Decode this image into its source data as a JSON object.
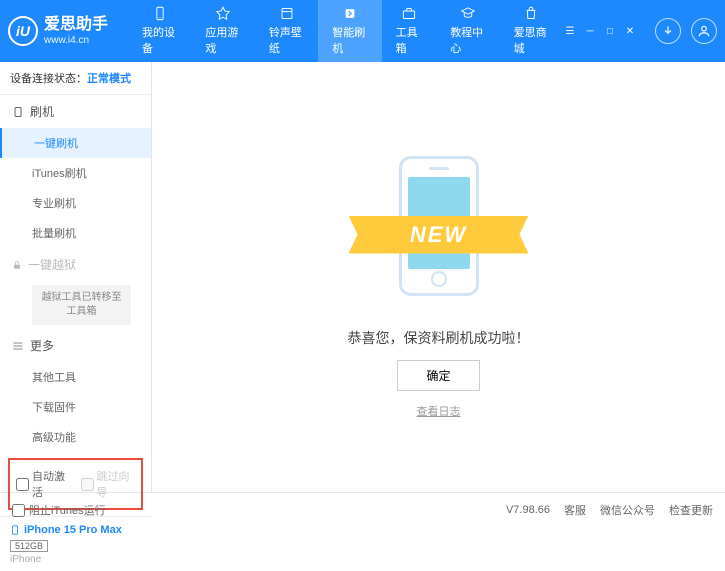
{
  "brand": {
    "title": "爱思助手",
    "url": "www.i4.cn",
    "logo_letter": "iU"
  },
  "topnav": {
    "items": [
      {
        "label": "我的设备"
      },
      {
        "label": "应用游戏"
      },
      {
        "label": "铃声壁纸"
      },
      {
        "label": "智能刷机"
      },
      {
        "label": "工具箱"
      },
      {
        "label": "教程中心"
      },
      {
        "label": "爱思商城"
      }
    ]
  },
  "sidebar": {
    "conn_label": "设备连接状态：",
    "conn_mode": "正常模式",
    "flash_section": "刷机",
    "items": {
      "onekey": "一键刷机",
      "itunes": "iTunes刷机",
      "pro": "专业刷机",
      "batch": "批量刷机"
    },
    "jailbreak_section": "一键越狱",
    "jailbreak_note": "越狱工具已转移至工具箱",
    "more_section": "更多",
    "more": {
      "other": "其他工具",
      "download": "下载固件",
      "advanced": "高级功能"
    },
    "checkboxes": {
      "auto_activate": "自动激活",
      "skip_guide": "跳过向导"
    },
    "device": {
      "name": "iPhone 15 Pro Max",
      "storage": "512GB",
      "type": "iPhone"
    }
  },
  "main": {
    "ribbon": "NEW",
    "success": "恭喜您，保资料刷机成功啦！",
    "ok": "确定",
    "view_log": "查看日志"
  },
  "footer": {
    "block_itunes": "阻止iTunes运行",
    "version": "V7.98.66",
    "support": "客服",
    "wechat": "微信公众号",
    "update": "检查更新"
  }
}
